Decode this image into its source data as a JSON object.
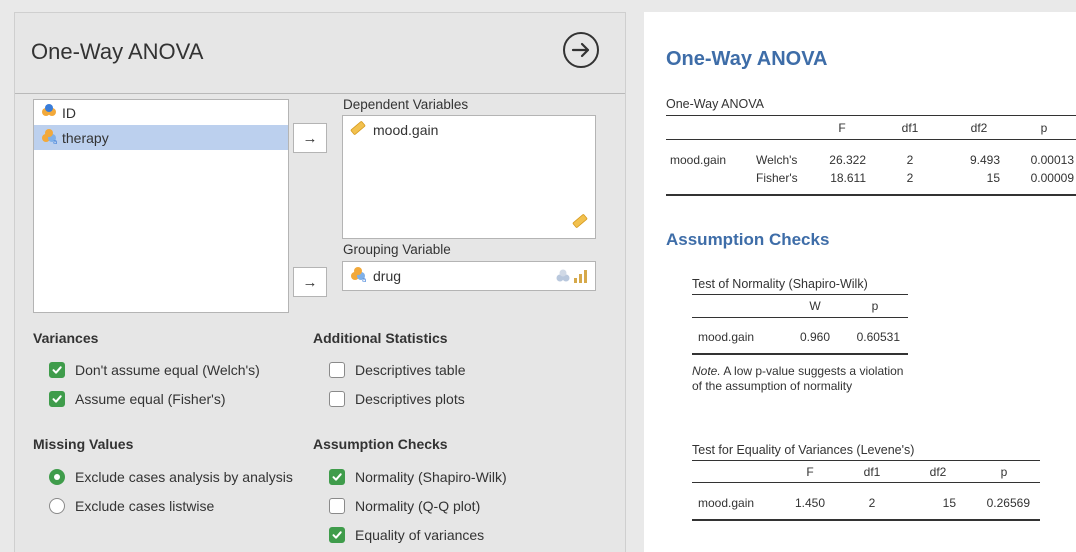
{
  "analysis": {
    "title": "One-Way ANOVA",
    "variables": [
      {
        "name": "ID",
        "type": "nominal-id",
        "selected": false
      },
      {
        "name": "therapy",
        "type": "nominal",
        "selected": true
      }
    ],
    "arrow_label": "→",
    "dependent": {
      "label": "Dependent Variables",
      "items": [
        "mood.gain"
      ]
    },
    "grouping": {
      "label": "Grouping Variable",
      "value": "drug"
    },
    "sections": {
      "variances": {
        "title": "Variances",
        "options": [
          {
            "label": "Don't assume equal (Welch's)",
            "checked": true
          },
          {
            "label": "Assume equal (Fisher's)",
            "checked": true
          }
        ]
      },
      "additional": {
        "title": "Additional Statistics",
        "options": [
          {
            "label": "Descriptives table",
            "checked": false
          },
          {
            "label": "Descriptives plots",
            "checked": false
          }
        ]
      },
      "missing": {
        "title": "Missing Values",
        "options": [
          {
            "label": "Exclude cases analysis by analysis",
            "selected": true
          },
          {
            "label": "Exclude cases listwise",
            "selected": false
          }
        ]
      },
      "assumptions": {
        "title": "Assumption Checks",
        "options": [
          {
            "label": "Normality (Shapiro-Wilk)",
            "checked": true
          },
          {
            "label": "Normality (Q-Q plot)",
            "checked": false
          },
          {
            "label": "Equality of variances",
            "checked": true
          }
        ]
      }
    }
  },
  "results": {
    "title": "One-Way ANOVA",
    "anova": {
      "title": "One-Way ANOVA",
      "headers": [
        "",
        "",
        "F",
        "df1",
        "df2",
        "p"
      ],
      "rows": [
        [
          "mood.gain",
          "Welch's",
          "26.322",
          "2",
          "9.493",
          "0.00013"
        ],
        [
          "",
          "Fisher's",
          "18.611",
          "2",
          "15",
          "0.00009"
        ]
      ]
    },
    "assumption_title": "Assumption Checks",
    "normality": {
      "title": "Test of Normality (Shapiro-Wilk)",
      "headers": [
        "",
        "W",
        "p"
      ],
      "row": [
        "mood.gain",
        "0.960",
        "0.60531"
      ],
      "note_label": "Note.",
      "note_text": " A low p-value suggests a violation of the assumption of normality"
    },
    "levene": {
      "title": "Test for Equality of Variances (Levene's)",
      "headers": [
        "",
        "F",
        "df1",
        "df2",
        "p"
      ],
      "row": [
        "mood.gain",
        "1.450",
        "2",
        "15",
        "0.26569"
      ]
    }
  },
  "colors": {
    "accent_green": "#3f9c4b",
    "heading_blue": "#3e6da8",
    "selection_blue": "#bcd0ee"
  }
}
